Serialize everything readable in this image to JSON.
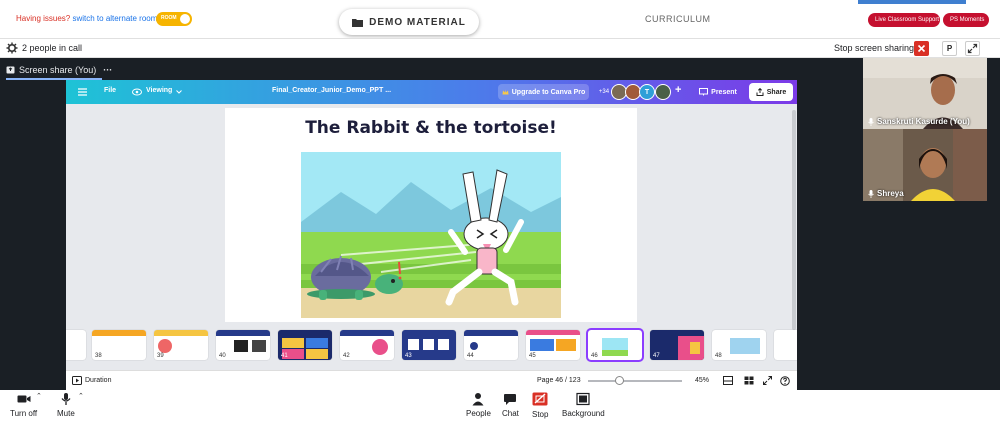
{
  "topbar": {
    "issues_text": "Having issues?",
    "issues_link": "switch to alternate room",
    "room_toggle_label": "ROOM",
    "demo_material": "DEMO MATERIAL",
    "curriculum": "CURRICULUM",
    "live_support": "Live Classroom Support",
    "ps_moments": "PS Moments",
    "brand_red": "#c5102f"
  },
  "callbar": {
    "people_count": "2 people in call",
    "stop_sharing": "Stop screen sharing",
    "p_label": "P"
  },
  "stage": {
    "share_tab_label": "Screen share (You)",
    "more_label": "···"
  },
  "canva": {
    "file_menu": "File",
    "viewing_menu": "Viewing",
    "doc_title": "Final_Creator_Junior_Demo_PPT ...",
    "upgrade": "Upgrade to Canva Pro",
    "collaborators_extra": "+34",
    "avatar_letter": "T",
    "add_label": "+",
    "present": "Present",
    "share": "Share",
    "slide_title": "The Rabbit & the tortoise!",
    "duration": "Duration",
    "page_indicator": "Page 46 / 123",
    "zoom_level": "45%",
    "zoom_fraction": 0.33,
    "thumbnails": [
      {
        "num": "38"
      },
      {
        "num": "39"
      },
      {
        "num": "40"
      },
      {
        "num": "41"
      },
      {
        "num": "42"
      },
      {
        "num": "43"
      },
      {
        "num": "44"
      },
      {
        "num": "45"
      },
      {
        "num": "46"
      },
      {
        "num": "47"
      },
      {
        "num": "48"
      }
    ],
    "selected_thumbnail": "46"
  },
  "participants": [
    {
      "name": "Sanskruti Kasurde (You)"
    },
    {
      "name": "Shreya"
    }
  ],
  "controls": {
    "camera": "Turn off",
    "mic": "Mute",
    "people": "People",
    "chat": "Chat",
    "stop": "Stop",
    "background": "Background"
  }
}
